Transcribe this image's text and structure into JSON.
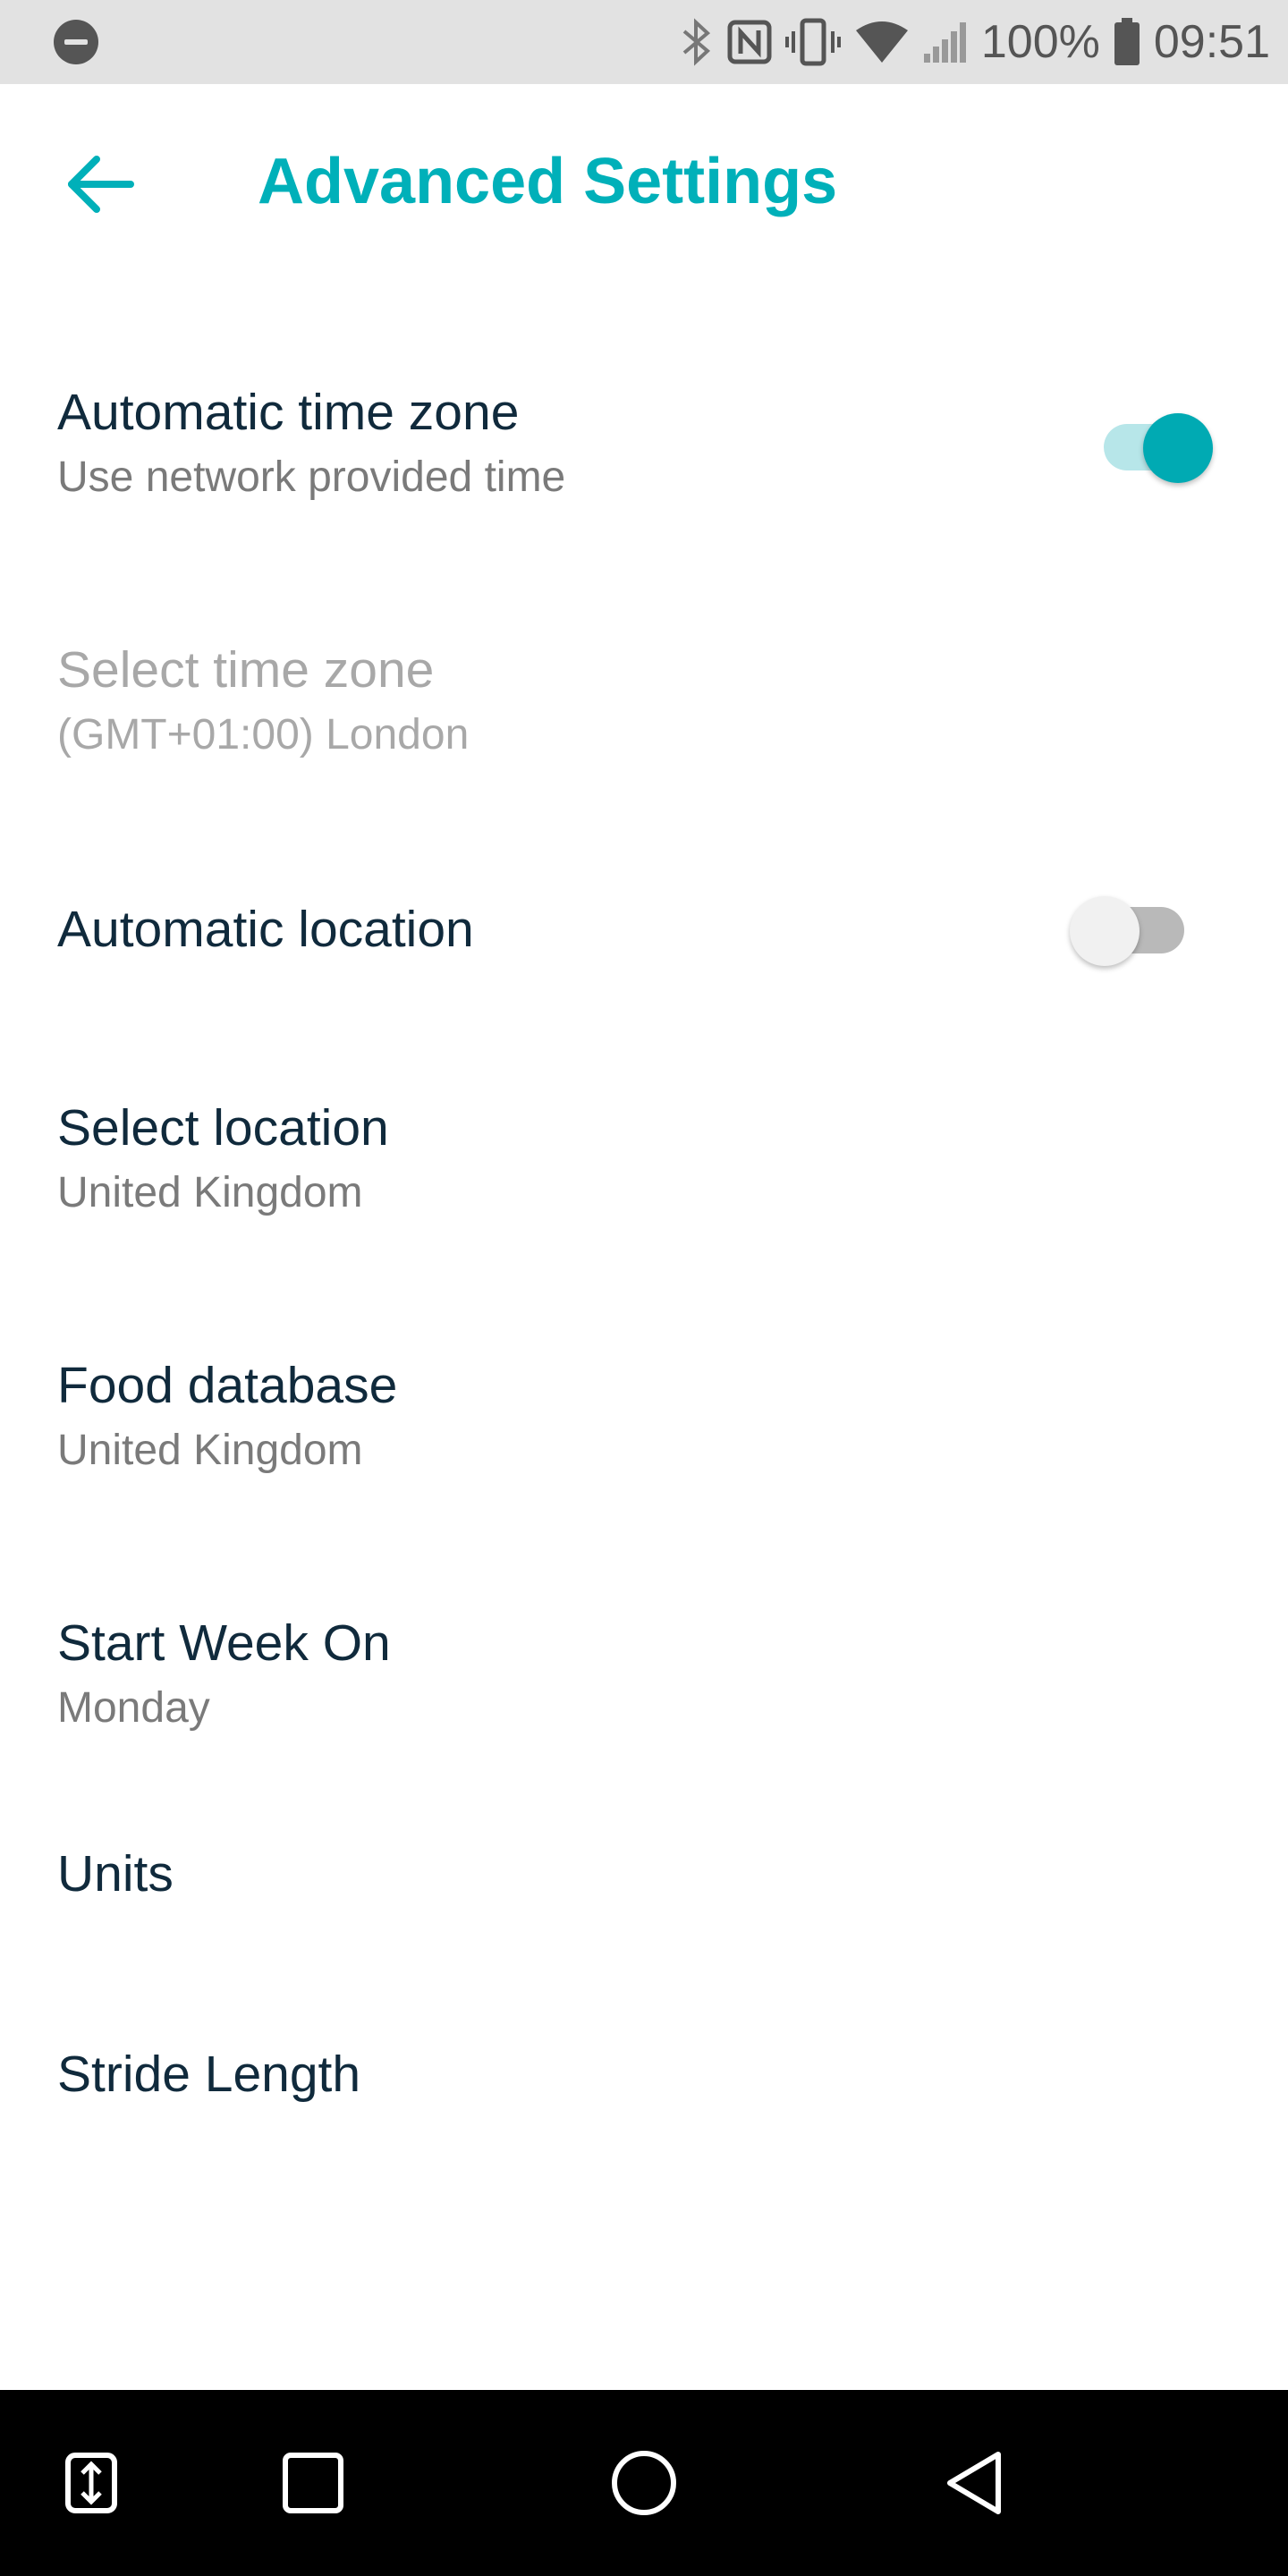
{
  "status_bar": {
    "battery_text": "100%",
    "time": "09:51",
    "icons": [
      "do-not-disturb-icon",
      "bluetooth-icon",
      "nfc-icon",
      "vibrate-icon",
      "wifi-icon",
      "signal-icon",
      "battery-icon"
    ]
  },
  "header": {
    "title": "Advanced Settings",
    "back_icon": "arrow-left-icon"
  },
  "settings": {
    "auto_time_zone": {
      "title": "Automatic time zone",
      "subtitle": "Use network provided time",
      "enabled": true
    },
    "select_time_zone": {
      "title": "Select time zone",
      "subtitle": "(GMT+01:00) London"
    },
    "auto_location": {
      "title": "Automatic location",
      "enabled": false
    },
    "select_location": {
      "title": "Select location",
      "subtitle": "United Kingdom"
    },
    "food_database": {
      "title": "Food database",
      "subtitle": "United Kingdom"
    },
    "start_week_on": {
      "title": "Start Week On",
      "subtitle": "Monday"
    },
    "units": {
      "title": "Units"
    },
    "stride_length": {
      "title": "Stride Length"
    }
  },
  "colors": {
    "accent": "#00b0b9",
    "text_primary": "#102a3c",
    "text_secondary": "#7a7a7a",
    "text_disabled": "#a8a8a8"
  },
  "nav_bar": {
    "icons": [
      "app-switch-icon",
      "recents-square-icon",
      "home-circle-icon",
      "back-triangle-icon"
    ]
  }
}
